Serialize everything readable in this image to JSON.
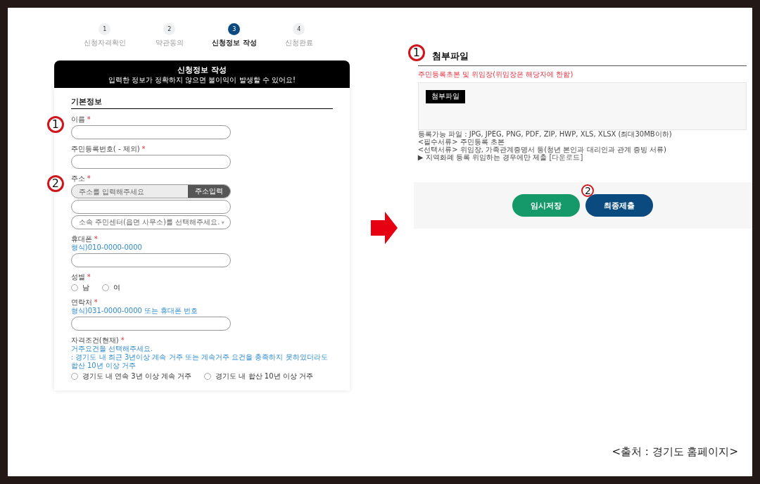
{
  "steps": [
    {
      "number": "1",
      "label": "신청자격확인",
      "selected": false
    },
    {
      "number": "2",
      "label": "약관동의",
      "selected": false
    },
    {
      "number": "3",
      "label": "신청정보 작성",
      "selected": true
    },
    {
      "number": "4",
      "label": "신청완료",
      "selected": false
    }
  ],
  "form": {
    "header_title": "신청정보 작성",
    "header_subtitle": "입력한 정보가 정확하지 않으면 불이익이 발생할 수 있어요!",
    "section_title": "기본정보",
    "fields": [
      {
        "kind": "text",
        "label": "이름",
        "required_mark": "*",
        "annotation": "1"
      },
      {
        "kind": "text",
        "label": "주민등록번호( - 제외)",
        "required_mark": "*"
      },
      {
        "kind": "address",
        "label": "주소",
        "required_mark": "*",
        "annotation": "2",
        "placeholder": "주소를 입력해주세요",
        "button": "주소입력",
        "select_placeholder": "소속 주민센터(읍면 사무소)를 선택해주세요.",
        "select_arrow": "▾"
      },
      {
        "kind": "text",
        "label": "휴대폰",
        "required_mark": "*",
        "hints": [
          "형식)010-0000-0000"
        ]
      },
      {
        "kind": "radio",
        "label": "성별",
        "required_mark": "*",
        "options": [
          {
            "label": "남",
            "selected": false
          },
          {
            "label": "여",
            "selected": false
          }
        ]
      },
      {
        "kind": "text",
        "label": "연락처",
        "required_mark": "*",
        "hints": [
          "형식)031-0000-0000 또는 휴대폰 번호"
        ]
      },
      {
        "kind": "radio",
        "label": "자격조건(현재)",
        "required_mark": "*",
        "hints": [
          "거주요건을 선택해주세요.",
          ": 경기도 내 최근 3년이상 계속 거주 또는 계속거주 요건을 충족하지 못하였더라도 합산 10년 이상 거주"
        ],
        "options": [
          {
            "label": "경기도 내 연속 3년 이상 계속 거주",
            "selected": false
          },
          {
            "label": "경기도 내 합산 10년 이상 거주",
            "selected": false
          }
        ]
      }
    ]
  },
  "attachment": {
    "title": "첨부파일",
    "annotation": "1",
    "requirement": "주민등록초본 및 위임장(위임장은 해당자에 한함)",
    "file_button": "첨부파일",
    "notes": [
      {
        "text": "등록가능 파일 : JPG, JPEG, PNG, PDF, ZIP, HWP, XLS, XLSX (최대30MB이하)"
      },
      {
        "text": "<필수서류> 주민등록 초본"
      },
      {
        "text": "<선택서류> 위임장, 가족관계증명서 등(청년 본인과 대리인과 관계 증빙 서류)"
      },
      {
        "text": "▶ 지역화폐 등록 위임하는 경우에만 제출",
        "link": "[다운로드]"
      }
    ]
  },
  "actions": [
    {
      "label": "임시저장",
      "kind": "secondary"
    },
    {
      "label": "최종제출",
      "kind": "primary",
      "annotation": "2"
    }
  ],
  "caption": "<출처 : 경기도 홈페이지>"
}
